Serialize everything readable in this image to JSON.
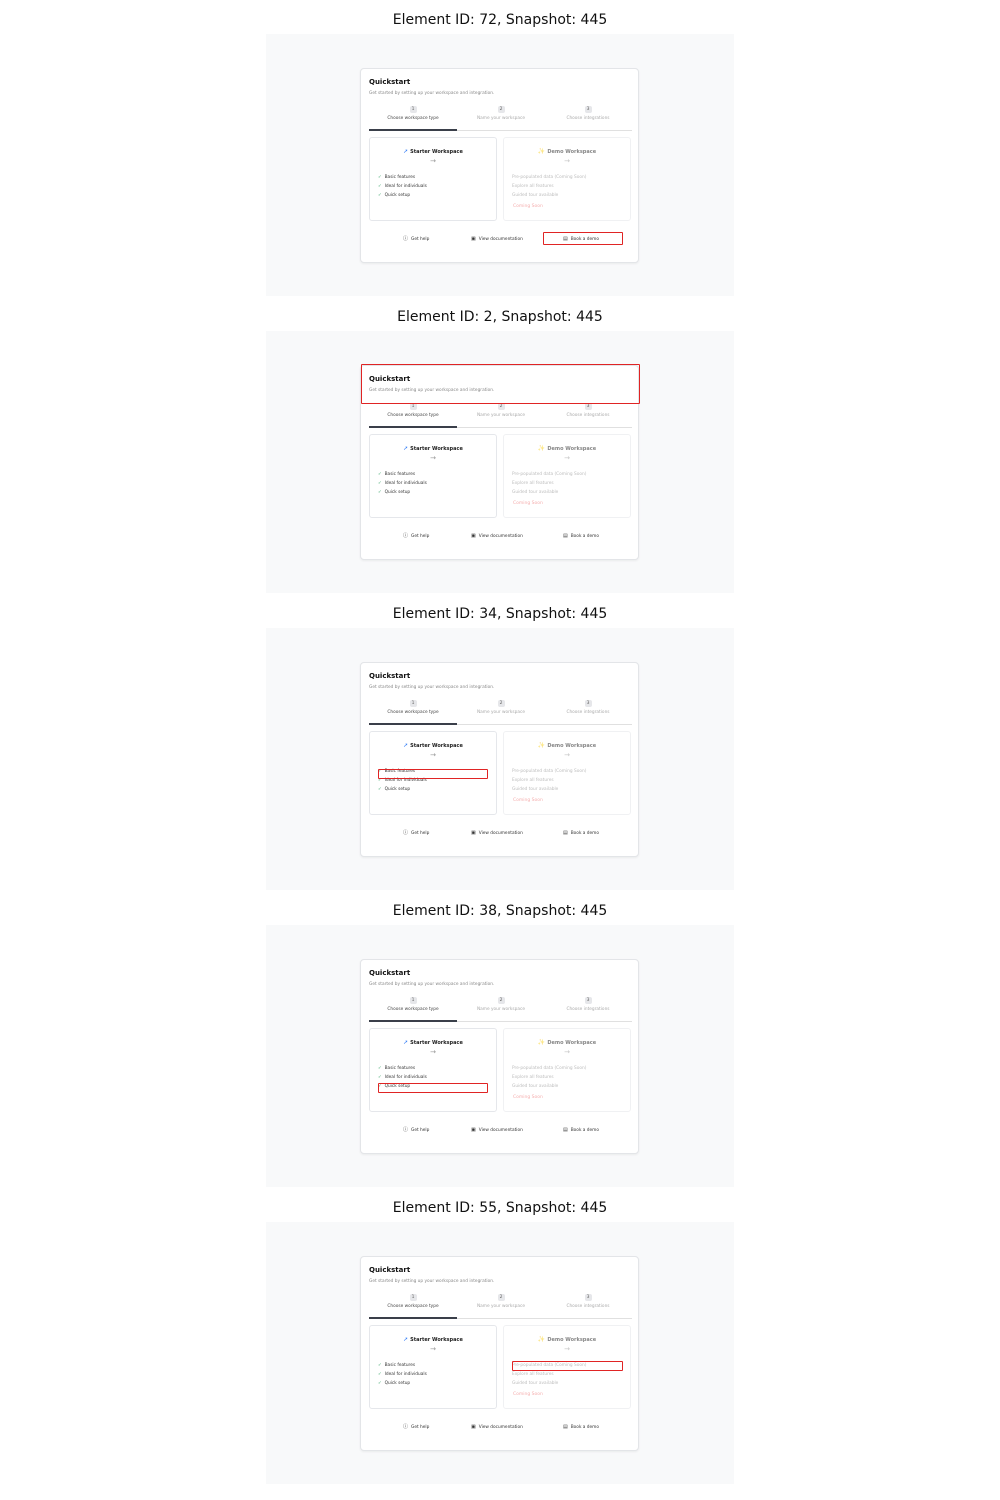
{
  "panels": [
    {
      "caption": "Element ID: 72, Snapshot: 445"
    },
    {
      "caption": "Element ID: 2, Snapshot: 445"
    },
    {
      "caption": "Element ID: 34, Snapshot: 445"
    },
    {
      "caption": "Element ID: 38, Snapshot: 445"
    },
    {
      "caption": "Element ID: 55, Snapshot: 445"
    }
  ],
  "quickstart": {
    "title": "Quickstart",
    "subtitle": "Get started by setting up your workspace and integration.",
    "steps": [
      {
        "number": "1",
        "label": "Choose workspace type"
      },
      {
        "number": "2",
        "label": "Name your workspace"
      },
      {
        "number": "3",
        "label": "Choose integrations"
      }
    ],
    "starter": {
      "title": "Starter Workspace",
      "icon": "rocket-icon",
      "arrow": "→",
      "features": [
        "Basic features",
        "Ideal for individuals",
        "Quick setup"
      ]
    },
    "demo": {
      "title": "Demo Workspace",
      "icon": "sparkle-icon",
      "arrow": "→",
      "features": [
        "Pre-populated data (Coming Soon)",
        "Explore all features",
        "Guided tour available"
      ],
      "badge": "Coming Soon"
    },
    "footer": {
      "help": "Get help",
      "docs": "View documentation",
      "demo": "Book a demo"
    }
  },
  "colors": {
    "highlight": "#e02424",
    "active_step": "#3a3f4a",
    "coming_soon": "#ee6b6b",
    "check": "#3aa66a"
  }
}
